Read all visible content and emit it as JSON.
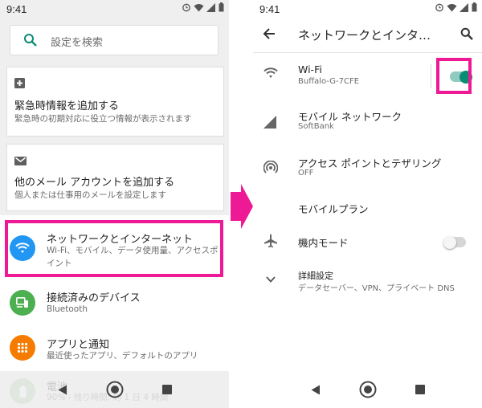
{
  "left": {
    "status": {
      "time": "9:41"
    },
    "search": {
      "placeholder": "設定を検索"
    },
    "cards": [
      {
        "title": "緊急時情報を追加する",
        "subtitle": "緊急時の初期対応に役立つ情報が表示されます",
        "icon": "plus-box-icon"
      },
      {
        "title": "他のメール アカウントを追加する",
        "subtitle": "個人または仕事用のメールを設定します",
        "icon": "mail-icon"
      }
    ],
    "rows": [
      {
        "title": "ネットワークとインターネット",
        "subtitle": "Wi-Fi、モバイル、データ使用量、アクセスポイント",
        "icon": "wifi-icon",
        "color": "#2196f3"
      },
      {
        "title": "接続済みのデバイス",
        "subtitle": "Bluetooth",
        "icon": "devices-icon",
        "color": "#4caf50"
      },
      {
        "title": "アプリと通知",
        "subtitle": "最近使ったアプリ、デフォルトのアプリ",
        "icon": "apps-grid-icon",
        "color": "#f57c00"
      },
      {
        "title": "電池",
        "subtitle": "90% - 残り時間: 約 1 日 4 時間",
        "icon": "battery-icon",
        "color": "#e8f0e8"
      }
    ]
  },
  "right": {
    "status": {
      "time": "9:41"
    },
    "header": {
      "title": "ネットワークとインタ…"
    },
    "items": [
      {
        "title": "Wi-Fi",
        "subtitle": "Buffalo-G-7CFE",
        "icon": "wifi-icon",
        "toggle": true
      },
      {
        "title": "モバイル ネットワーク",
        "subtitle": "SoftBank",
        "icon": "cellular-signal-icon"
      },
      {
        "title": "アクセス ポイントとテザリング",
        "subtitle": "OFF",
        "icon": "hotspot-icon"
      },
      {
        "title": "モバイルプラン",
        "subtitle": "",
        "icon": ""
      },
      {
        "title": "機内モード",
        "subtitle": "",
        "icon": "airplane-icon",
        "toggle": false
      },
      {
        "title": "詳細設定",
        "subtitle": "データセーバー、VPN、プライベート DNS",
        "icon": "chevron-down-icon"
      }
    ]
  },
  "colors": {
    "highlight": "#ee1a95",
    "accent": "#0b8c74",
    "arrow": "#ee1a95"
  }
}
